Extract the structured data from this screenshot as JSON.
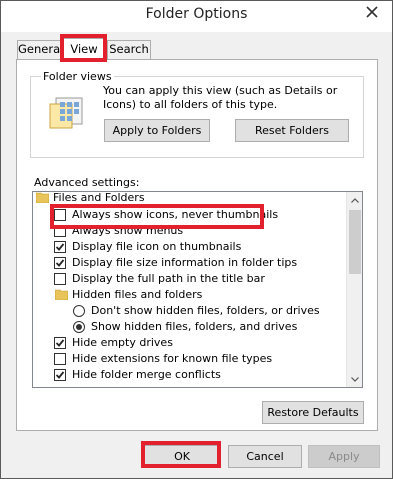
{
  "window": {
    "title": "Folder Options"
  },
  "tabs": [
    {
      "label": "General",
      "selected": false
    },
    {
      "label": "View",
      "selected": true
    },
    {
      "label": "Search",
      "selected": false
    }
  ],
  "folder_views": {
    "group_label": "Folder views",
    "description": "You can apply this view (such as Details or Icons) to all folders of this type.",
    "apply_button": "Apply to Folders",
    "reset_button": "Reset Folders"
  },
  "advanced": {
    "label": "Advanced settings:",
    "items": [
      {
        "type": "folder",
        "label": "Files and Folders"
      },
      {
        "type": "checkbox",
        "label": "Always show icons, never thumbnails",
        "checked": false
      },
      {
        "type": "checkbox",
        "label": "Always show menus",
        "checked": false
      },
      {
        "type": "checkbox",
        "label": "Display file icon on thumbnails",
        "checked": true
      },
      {
        "type": "checkbox",
        "label": "Display file size information in folder tips",
        "checked": true
      },
      {
        "type": "checkbox",
        "label": "Display the full path in the title bar",
        "checked": false
      },
      {
        "type": "folder",
        "label": "Hidden files and folders"
      },
      {
        "type": "radio",
        "label": "Don't show hidden files, folders, or drives",
        "selected": false
      },
      {
        "type": "radio",
        "label": "Show hidden files, folders, and drives",
        "selected": true
      },
      {
        "type": "checkbox",
        "label": "Hide empty drives",
        "checked": true
      },
      {
        "type": "checkbox",
        "label": "Hide extensions for known file types",
        "checked": false
      },
      {
        "type": "checkbox",
        "label": "Hide folder merge conflicts",
        "checked": true
      }
    ],
    "restore_button": "Restore Defaults"
  },
  "footer": {
    "ok": "OK",
    "cancel": "Cancel",
    "apply": "Apply"
  },
  "colors": {
    "highlight": "#e3202d",
    "folder": "#e8c45a"
  }
}
